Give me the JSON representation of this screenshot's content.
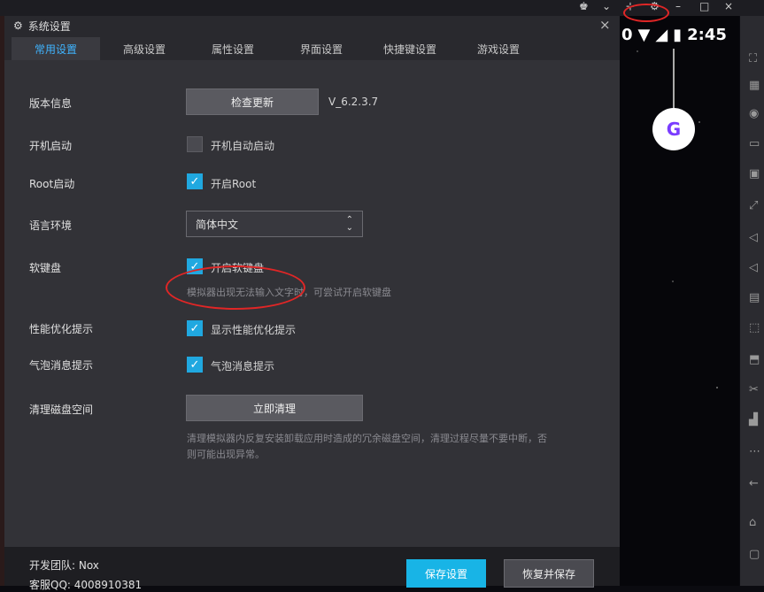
{
  "dialog": {
    "title": "系统设置",
    "close": "×"
  },
  "tabs": [
    "常用设置",
    "高级设置",
    "属性设置",
    "界面设置",
    "快捷键设置",
    "游戏设置"
  ],
  "settings": {
    "version": {
      "label": "版本信息",
      "button": "检查更新",
      "value": "V_6.2.3.7"
    },
    "autostart": {
      "label": "开机启动",
      "checkbox": "开机自动启动",
      "checked": false
    },
    "root": {
      "label": "Root启动",
      "checkbox": "开启Root",
      "checked": true
    },
    "language": {
      "label": "语言环境",
      "value": "简体中文"
    },
    "softkeyboard": {
      "label": "软键盘",
      "checkbox": "开启软键盘",
      "checked": true,
      "hint": "模拟器出现无法输入文字时，可尝试开启软键盘"
    },
    "perf": {
      "label": "性能优化提示",
      "checkbox": "显示性能优化提示",
      "checked": true
    },
    "bubble": {
      "label": "气泡消息提示",
      "checkbox": "气泡消息提示",
      "checked": true
    },
    "disk": {
      "label": "清理磁盘空间",
      "button": "立即清理",
      "hint1": "清理模拟器内反复安装卸载应用时造成的冗余磁盘空间，清理过程尽量不要中断，否",
      "hint2": "则可能出现异常。"
    }
  },
  "footer": {
    "team": "开发团队: Nox",
    "qq": "客服QQ: 4008910381",
    "save": "保存设置",
    "restore": "恢复并保存"
  },
  "statusbar": {
    "time": "2:45",
    "signal": "0"
  },
  "window_controls": {
    "minimize": "–",
    "maximize": "□",
    "close": "×"
  },
  "avatar_letter": "G",
  "colors": {
    "accent": "#20a8e0",
    "active_tab": "#3fb4ff",
    "annotation": "#e02626"
  }
}
